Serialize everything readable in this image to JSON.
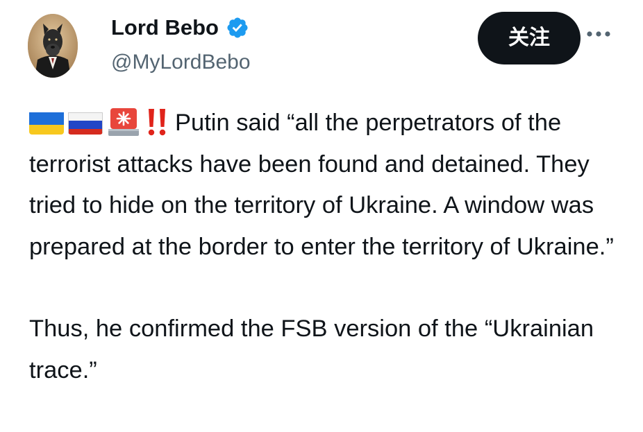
{
  "author": {
    "name": "Lord Bebo",
    "handle": "@MyLordBebo",
    "verified_color": "#1d9bf0"
  },
  "actions": {
    "follow_label": "关注",
    "more_icon": "more-horizontal-icon"
  },
  "post": {
    "emojis": [
      "ukraine-flag-icon",
      "russia-flag-icon",
      "siren-icon",
      "double-exclamation-icon"
    ],
    "paragraph_1": "Putin said “all the perpetrators of the terrorist attacks have been found and detained. They tried to hide on the territory of Ukraine. A window was prepared at the border to enter the territory of Ukraine.”",
    "paragraph_2": "Thus, he confirmed the FSB version of the “Ukrainian trace.”"
  },
  "colors": {
    "text": "#0f1419",
    "handle": "#536471",
    "button_bg": "#0f1419",
    "button_text": "#ffffff"
  }
}
